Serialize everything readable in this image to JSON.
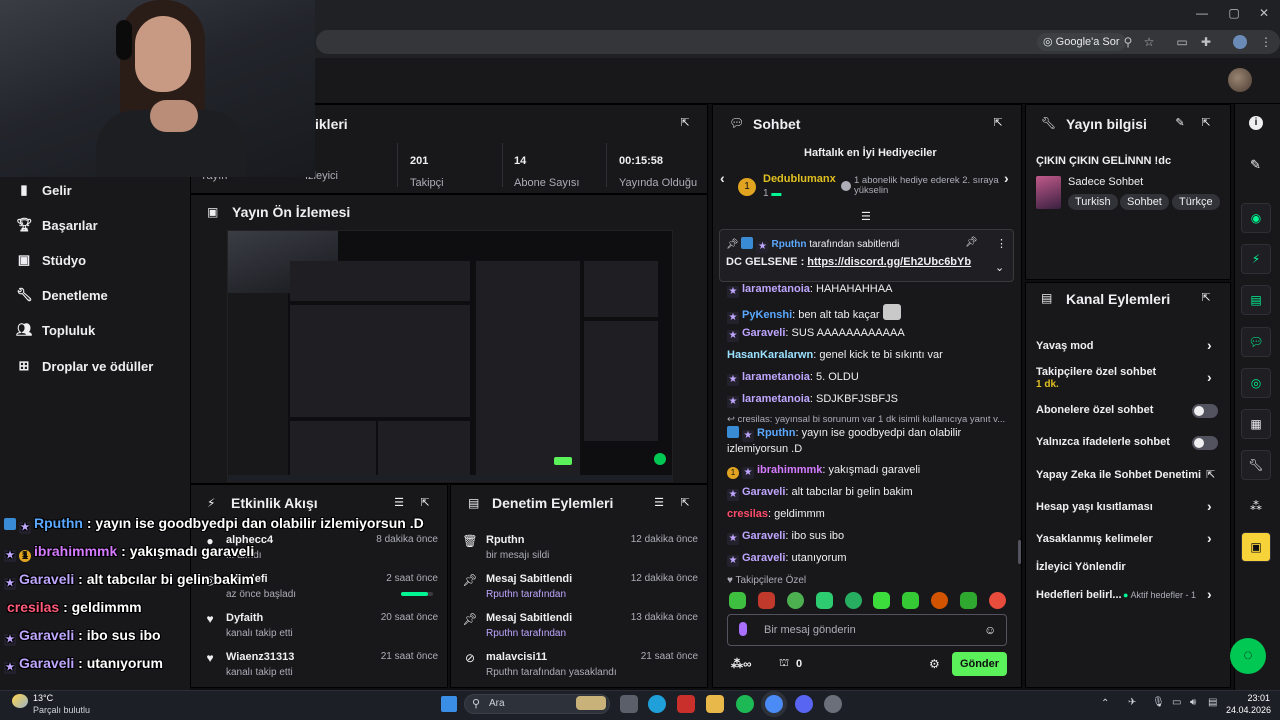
{
  "browser": {
    "search_chip": "Google'a Sor",
    "icons": [
      "zoom-icon",
      "star-icon",
      "cast-icon",
      "extensions-icon",
      "profile-icon",
      "menu-icon"
    ]
  },
  "sidebar": {
    "items": [
      {
        "label": "Gelir",
        "icon": "coin-icon",
        "has_chevron": false
      },
      {
        "label": "Başarılar",
        "icon": "trophy-icon",
        "has_chevron": false
      },
      {
        "label": "Stüdyo",
        "icon": "studio-icon",
        "has_chevron": true
      },
      {
        "label": "Denetleme",
        "icon": "wrench-icon",
        "has_chevron": false
      },
      {
        "label": "Topluluk",
        "icon": "community-icon",
        "has_chevron": true
      },
      {
        "label": "Droplar ve ödüller",
        "icon": "drops-icon",
        "has_chevron": false
      }
    ]
  },
  "stats": {
    "title_partial": "ikleri",
    "items": [
      {
        "value": "",
        "label": "Yayın"
      },
      {
        "value": "",
        "label": "İzleyici"
      },
      {
        "value": "201",
        "label": "Takipçi"
      },
      {
        "value": "14",
        "label": "Abone Sayısı"
      },
      {
        "value": "00:15:58",
        "label": "Yayında Olduğu"
      }
    ]
  },
  "preview": {
    "title": "Yayın Ön İzlemesi"
  },
  "activity": {
    "title": "Etkinlik Akışı",
    "items": [
      {
        "who": "alphecc4",
        "what": "... alındı",
        "when": "8 dakika önce",
        "icon": "gift-icon"
      },
      {
        "who": "...hedefi",
        "what": "az önce başladı",
        "when": "2 saat önce",
        "icon": "goal-icon",
        "progress": 0.85
      },
      {
        "who": "Dyfaith",
        "what": "kanalı takip etti",
        "when": "20 saat önce",
        "icon": "heart-icon"
      },
      {
        "who": "Wiaenz31313",
        "what": "kanalı takip etti",
        "when": "21 saat önce",
        "icon": "heart-icon"
      }
    ]
  },
  "moderation": {
    "title": "Denetim Eylemleri",
    "items": [
      {
        "who": "Rputhn",
        "what": "bir mesajı sildi",
        "when": "12 dakika önce",
        "icon": "trash-icon"
      },
      {
        "who": "Mesaj Sabitlendi",
        "what": "Rputhn tarafından",
        "when": "12 dakika önce",
        "icon": "pin-icon"
      },
      {
        "who": "Mesaj Sabitlendi",
        "what": "Rputhn tarafından",
        "when": "13 dakika önce",
        "icon": "pin-icon"
      },
      {
        "who": "malavcisi11",
        "what": "Rputhn tarafından yasaklandı",
        "when": "21 saat önce",
        "icon": "ban-icon"
      }
    ]
  },
  "chat": {
    "title": "Sohbet",
    "gifters_title": "Haftalık en İyi Hediyeciler",
    "top_gifter": {
      "name": "Dedublumanx",
      "count": "1"
    },
    "gifter_note": "1 abonelik hediye ederek 2. sıraya yükselin",
    "pinned": {
      "by": "Rputhn",
      "by_suffix": "tarafından sabitlendi",
      "prefix": "DC GELSENE : ",
      "link": "https://discord.gg/Eh2Ubc6bYb"
    },
    "messages": [
      {
        "user": "larametanoia",
        "color": "#bfa6ff",
        "text": "HAHAHAHHAA"
      },
      {
        "user": "PyKenshi",
        "color": "#5aa8ff",
        "text": "ben alt tab kaçar"
      },
      {
        "user": "Garaveli",
        "color": "#bfa6ff",
        "text": "SUS AAAAAAAAAAAA"
      },
      {
        "user": "HasanKaralarwn",
        "color": "#9be0ff",
        "text": "genel kick te bi sıkıntı var"
      },
      {
        "user": "larametanoia",
        "color": "#bfa6ff",
        "text": "5. OLDU"
      },
      {
        "user": "larametanoia",
        "color": "#bfa6ff",
        "text": "SDJKBFJSBFJS"
      },
      {
        "user": "Rputhn",
        "color": "#5aa8ff",
        "text": "yayın ise goodbyedpi dan olabilir izlemiyorsun .D",
        "reply": "cresilas: yayınsal bi sorunum var 1 dk isimli kullanıcıya yanıt v..."
      },
      {
        "user": "ibrahimmmk",
        "color": "#d57bff",
        "text": "yakışmadı garaveli"
      },
      {
        "user": "Garaveli",
        "color": "#bfa6ff",
        "text": "alt tabcılar bi gelin bakim"
      },
      {
        "user": "cresilas",
        "color": "#ff4a6a",
        "text": "geldimmm"
      },
      {
        "user": "Garaveli",
        "color": "#bfa6ff",
        "text": "ibo sus ibo"
      },
      {
        "user": "Garaveli",
        "color": "#bfa6ff",
        "text": "utanıyorum"
      }
    ],
    "followers_only": "Takipçilere Özel",
    "input_placeholder": "Bir mesaj gönderin",
    "points": "0",
    "send": "Gönder"
  },
  "stream_info": {
    "title": "Yayın bilgisi",
    "stream_title": "ÇIKIN ÇIKIN GELİNNN !dc",
    "category": "Sadece Sohbet",
    "tags": [
      "Turkish",
      "Sohbet",
      "Türkçe"
    ]
  },
  "channel_actions": {
    "title": "Kanal Eylemleri",
    "rows": [
      {
        "label": "Yavaş mod",
        "control": "chevron"
      },
      {
        "label": "Takipçilere özel sohbet",
        "sub": "1 dk.",
        "control": "chevron"
      },
      {
        "label": "Abonelere özel sohbet",
        "control": "toggle"
      },
      {
        "label": "Yalnızca ifadelerle sohbet",
        "control": "toggle"
      },
      {
        "label": "Yapay Zeka ile Sohbet Denetimi",
        "control": "external"
      },
      {
        "label": "Hesap yaşı kısıtlaması",
        "control": "chevron"
      },
      {
        "label": "Yasaklanmış kelimeler",
        "control": "chevron"
      },
      {
        "label": "İzleyici Yönlendir",
        "control": "none"
      },
      {
        "label": "Hedefleri belirl...",
        "sub_inline": "Aktif hedefler - 1",
        "control": "chevron"
      }
    ]
  },
  "overlay_chat": [
    {
      "user": "Rputhn",
      "color": "#5aa8ff",
      "text": ": yayın ise goodbyedpi dan olabilir izlemiyorsun .D"
    },
    {
      "user": "ibrahimmmk",
      "color": "#d57bff",
      "text": ": yakışmadı garaveli"
    },
    {
      "user": "Garaveli",
      "color": "#bfa6ff",
      "text": ": alt tabcılar bi gelin bakim"
    },
    {
      "user": "cresilas",
      "color": "#ff5a7a",
      "text": ": geldimmm"
    },
    {
      "user": "Garaveli",
      "color": "#bfa6ff",
      "text": ": ibo sus ibo"
    },
    {
      "user": "Garaveli",
      "color": "#bfa6ff",
      "text": ": utanıyorum"
    }
  ],
  "taskbar": {
    "weather_temp": "13°C",
    "weather_desc": "Parçalı bulutlu",
    "search_placeholder": "Ara",
    "time": "23:01",
    "date": "24.04.2026"
  },
  "colors": {
    "accent_green": "#00f593",
    "send_green": "#5bf15b",
    "panel": "#18181b",
    "bg": "#0e0e10"
  }
}
